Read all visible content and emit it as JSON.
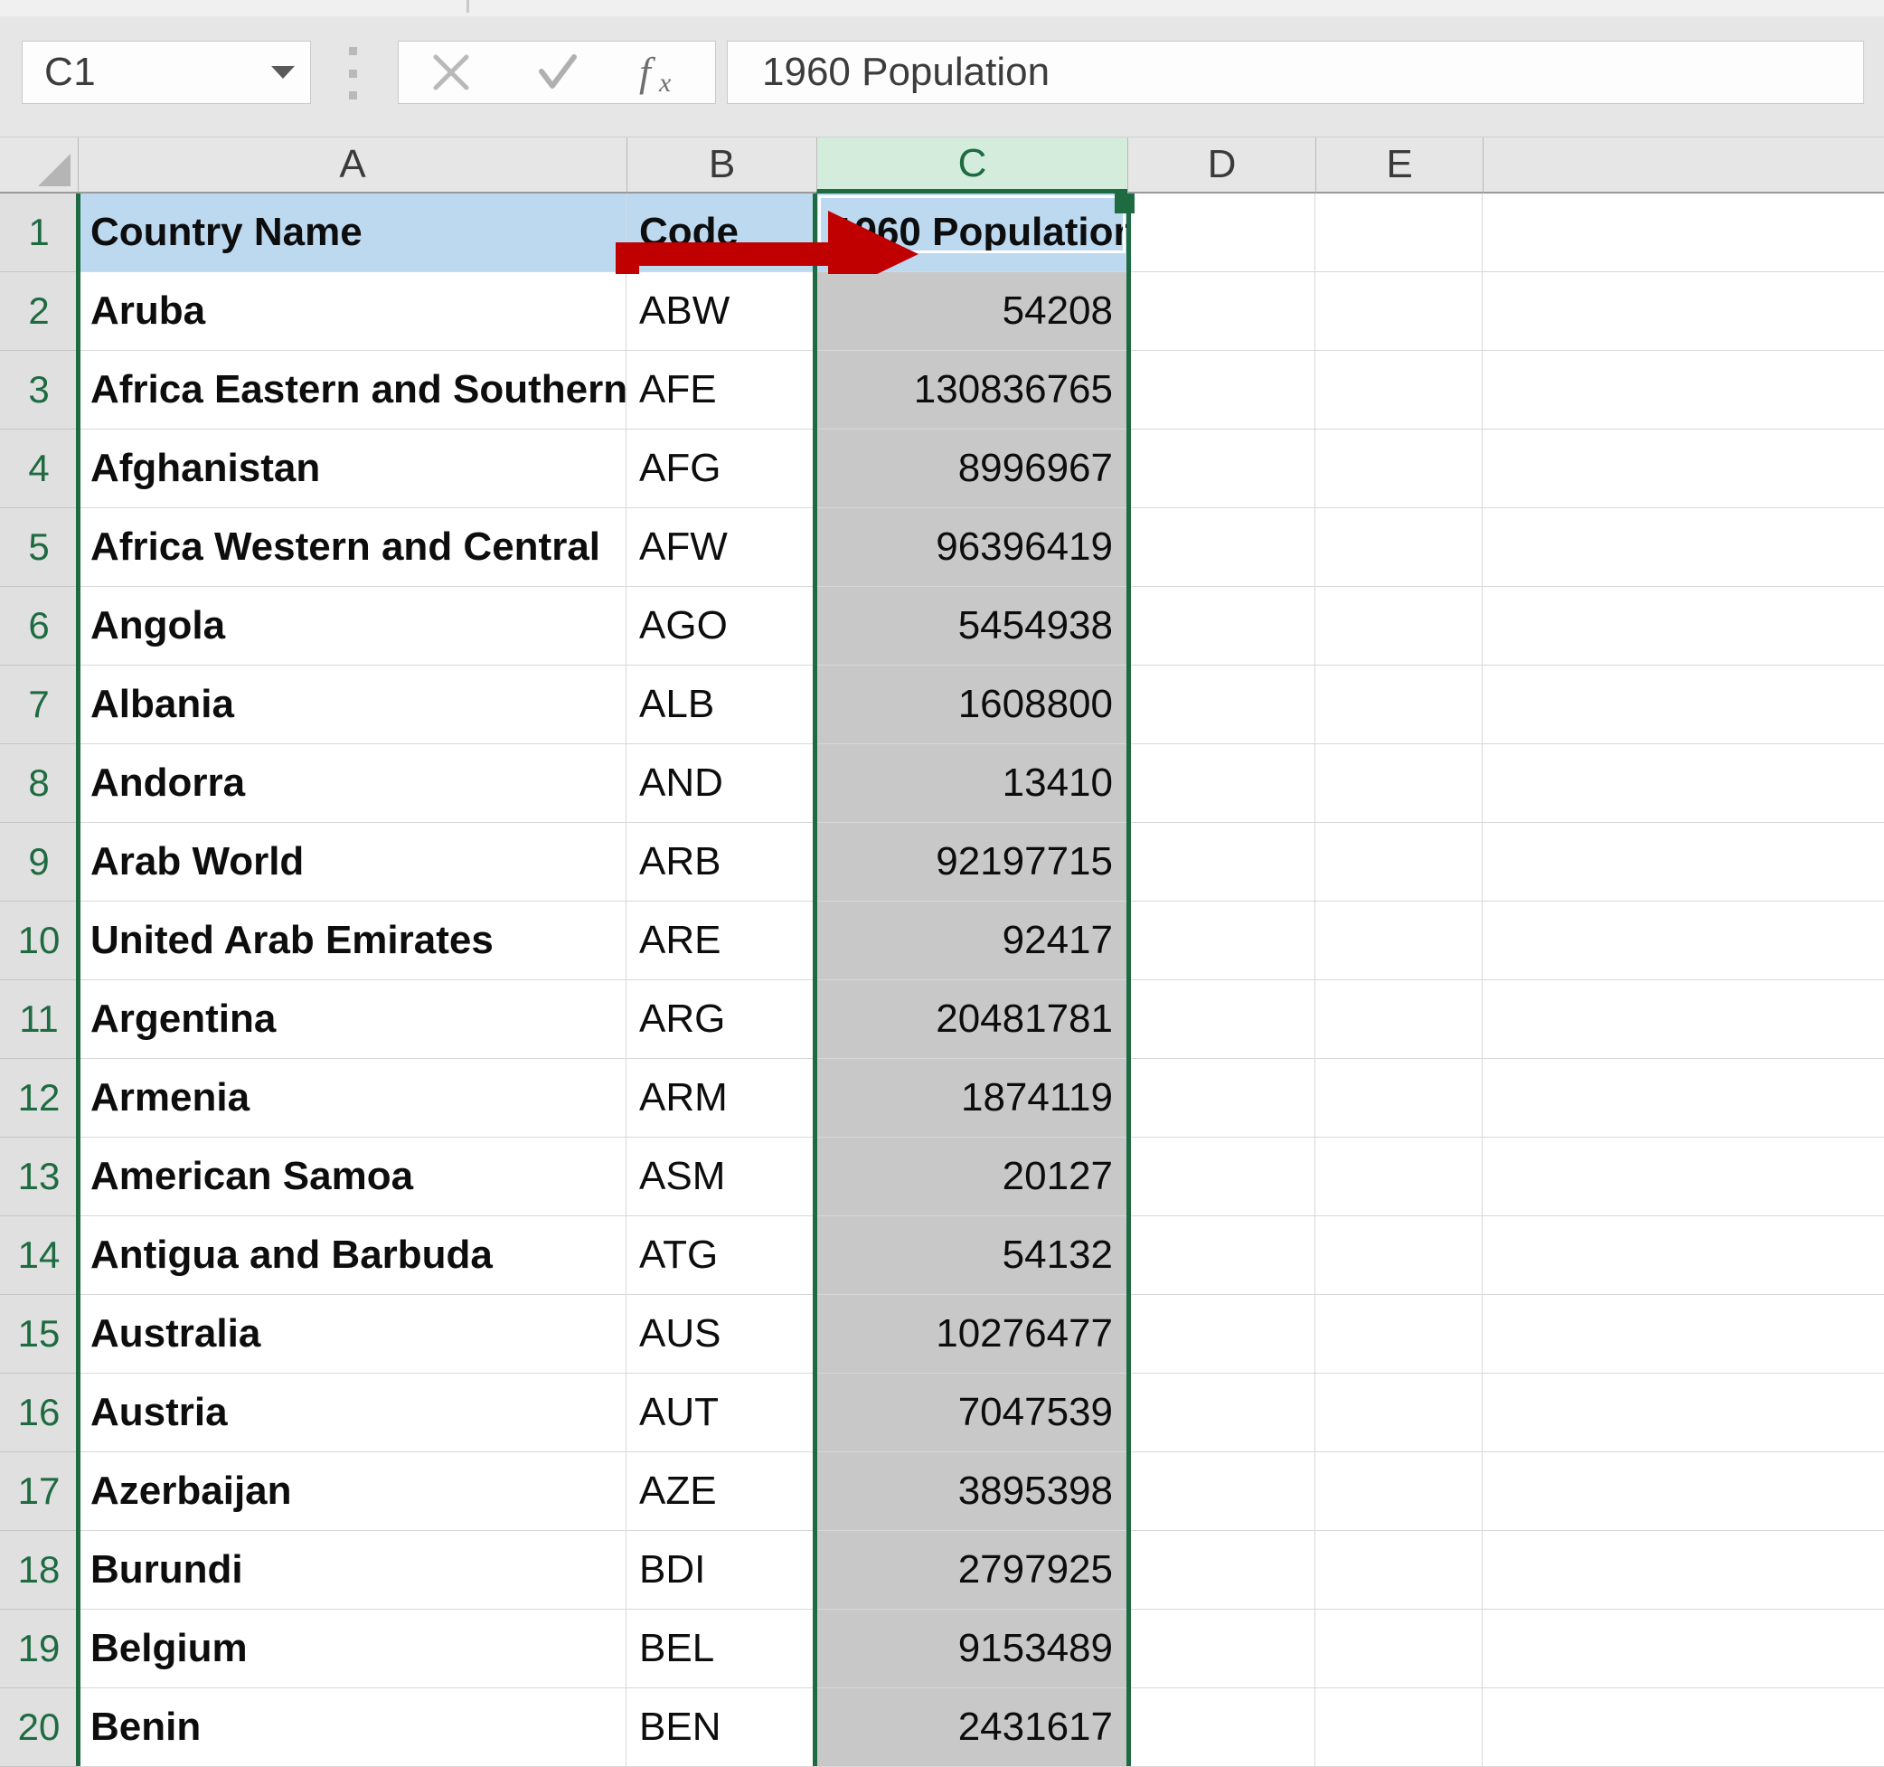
{
  "app": "excel-spreadsheet",
  "formula_bar": {
    "name_box_value": "C1",
    "name_box_dropdown_icon": "chevron-down-icon",
    "grip_icon": "drag-grip-icon",
    "cancel_icon": "cancel-x-icon",
    "confirm_icon": "confirm-check-icon",
    "insert_function_icon": "fx-icon",
    "formula_value": "1960 Population"
  },
  "grid": {
    "select_all_icon": "select-all-corner-icon",
    "column_headers": [
      "A",
      "B",
      "C",
      "D",
      "E"
    ],
    "selected_column": "C",
    "row_numbers": [
      "1",
      "2",
      "3",
      "4",
      "5",
      "6",
      "7",
      "8",
      "9",
      "10",
      "11",
      "12",
      "13",
      "14",
      "15",
      "16",
      "17",
      "18",
      "19",
      "20"
    ],
    "header_row": {
      "a": "Country Name",
      "b": "Code",
      "c": "1960 Population"
    },
    "rows": [
      {
        "n": "2",
        "country": "Aruba",
        "code": "ABW",
        "pop": "54208"
      },
      {
        "n": "3",
        "country": "Africa Eastern and Southern",
        "code": "AFE",
        "pop": "130836765"
      },
      {
        "n": "4",
        "country": "Afghanistan",
        "code": "AFG",
        "pop": "8996967"
      },
      {
        "n": "5",
        "country": "Africa Western and Central",
        "code": "AFW",
        "pop": "96396419"
      },
      {
        "n": "6",
        "country": "Angola",
        "code": "AGO",
        "pop": "5454938"
      },
      {
        "n": "7",
        "country": "Albania",
        "code": "ALB",
        "pop": "1608800"
      },
      {
        "n": "8",
        "country": "Andorra",
        "code": "AND",
        "pop": "13410"
      },
      {
        "n": "9",
        "country": "Arab World",
        "code": "ARB",
        "pop": "92197715"
      },
      {
        "n": "10",
        "country": "United Arab Emirates",
        "code": "ARE",
        "pop": "92417"
      },
      {
        "n": "11",
        "country": "Argentina",
        "code": "ARG",
        "pop": "20481781"
      },
      {
        "n": "12",
        "country": "Armenia",
        "code": "ARM",
        "pop": "1874119"
      },
      {
        "n": "13",
        "country": "American Samoa",
        "code": "ASM",
        "pop": "20127"
      },
      {
        "n": "14",
        "country": "Antigua and Barbuda",
        "code": "ATG",
        "pop": "54132"
      },
      {
        "n": "15",
        "country": "Australia",
        "code": "AUS",
        "pop": "10276477"
      },
      {
        "n": "16",
        "country": "Austria",
        "code": "AUT",
        "pop": "7047539"
      },
      {
        "n": "17",
        "country": "Azerbaijan",
        "code": "AZE",
        "pop": "3895398"
      },
      {
        "n": "18",
        "country": "Burundi",
        "code": "BDI",
        "pop": "2797925"
      },
      {
        "n": "19",
        "country": "Belgium",
        "code": "BEL",
        "pop": "9153489"
      },
      {
        "n": "20",
        "country": "Benin",
        "code": "BEN",
        "pop": "2431617"
      }
    ]
  },
  "annotation": {
    "arrow_icon": "red-right-arrow-annotation",
    "arrow_color": "#c00000"
  },
  "colors": {
    "selection_green": "#1e6b41",
    "header_row_blue": "#bcd9f0",
    "selected_column_gray": "#c8c8c8",
    "column_header_selected_green": "#d3ecdc",
    "chrome_gray": "#e6e6e6"
  }
}
